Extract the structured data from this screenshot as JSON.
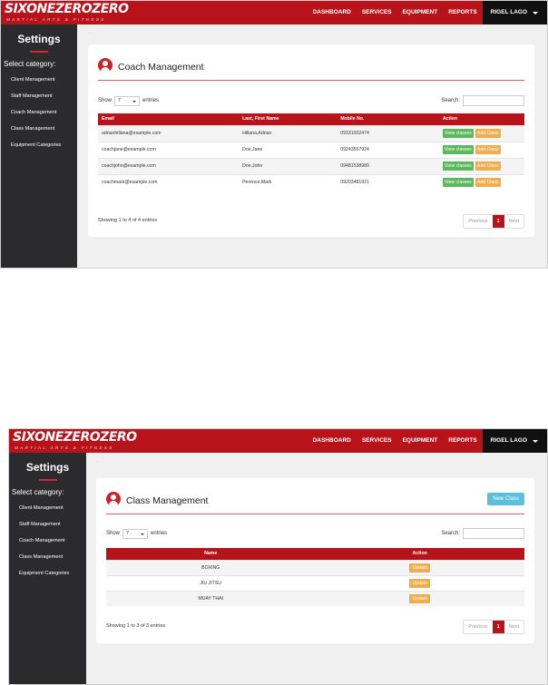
{
  "brand": {
    "name": "SIXONEZEROZERO",
    "tagline": "MARTIAL ARTS & FITNESS"
  },
  "nav": {
    "links": [
      "DASHBOARD",
      "SERVICES",
      "EQUIPMENT",
      "REPORTS"
    ],
    "user": "RIGEL LAGO"
  },
  "sidebar": {
    "title": "Settings",
    "subtitle": "Select category:",
    "items": [
      "Client Management",
      "Staff Management",
      "Coach Management",
      "Class Management",
      "Equipment Categories"
    ]
  },
  "colors": {
    "brand_red": "#b8121b",
    "sidebar_bg": "#2b2b2e",
    "green": "#5cb85c",
    "orange": "#f0ad4e",
    "info_blue": "#5bc0de"
  },
  "icons": {
    "header": "user-circle-icon"
  },
  "coach": {
    "breadcrumb": ".",
    "title": "Coach Management",
    "show_label": "Show",
    "entries_value": "7",
    "entries_label": "entries",
    "search_label": "Search:",
    "search_value": "",
    "columns": [
      "Email",
      "Last, First Name",
      "Mobile No.",
      "Action"
    ],
    "rows": [
      {
        "email": "adrianhillana@example.com",
        "name": "Hillana,Adrian",
        "mobile": "09331932474"
      },
      {
        "email": "coachjane@example.com",
        "name": "Doe,Jane",
        "mobile": "09243557924"
      },
      {
        "email": "coachjohn@example.com",
        "name": "Doe,John",
        "mobile": "09481538989"
      },
      {
        "email": "coachmark@example.com",
        "name": "Perence,Mark",
        "mobile": "09203481921"
      }
    ],
    "view_label": "View classes",
    "add_label": "Add Class",
    "info": "Showing 1 to 4 of 4 entries",
    "pager": {
      "prev": "Previous",
      "page": "1",
      "next": "Next"
    }
  },
  "classmgmt": {
    "breadcrumb": ".",
    "title": "Class Management",
    "new_label": "New Class",
    "show_label": "Show",
    "entries_value": "7",
    "entries_label": "entries",
    "search_label": "Search:",
    "search_value": "",
    "columns": [
      "Name",
      "Action"
    ],
    "rows": [
      {
        "name": "BOXING"
      },
      {
        "name": "JIU JITSU"
      },
      {
        "name": "MUAY THAI"
      }
    ],
    "update_label": "Update",
    "info": "Showing 1 to 3 of 3 entries",
    "pager": {
      "prev": "Previous",
      "page": "1",
      "next": "Next"
    }
  }
}
